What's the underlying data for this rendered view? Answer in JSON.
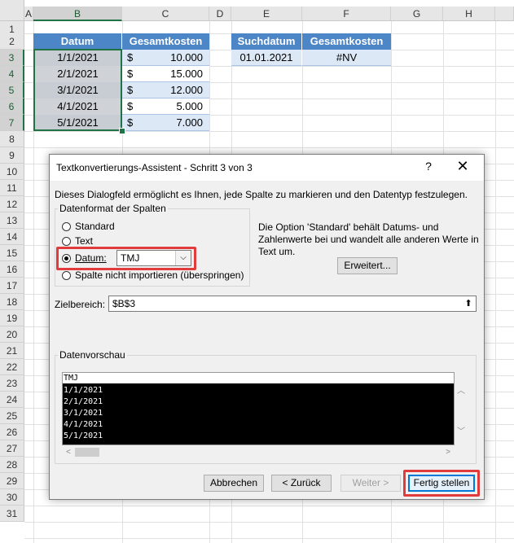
{
  "columns": [
    "A",
    "B",
    "C",
    "D",
    "E",
    "F",
    "G",
    "H"
  ],
  "rows": [
    "1",
    "2",
    "3",
    "4",
    "5",
    "6",
    "7",
    "8",
    "9",
    "10",
    "11",
    "12",
    "13",
    "14",
    "15",
    "16",
    "17",
    "18",
    "19",
    "20",
    "21",
    "22",
    "23",
    "24",
    "25",
    "26",
    "27",
    "28",
    "29",
    "30",
    "31"
  ],
  "table1": {
    "headers": [
      "Datum",
      "Gesamtkosten"
    ],
    "currency": "$",
    "rows": [
      {
        "date": "1/1/2021",
        "cost": "10.000"
      },
      {
        "date": "2/1/2021",
        "cost": "15.000"
      },
      {
        "date": "3/1/2021",
        "cost": "12.000"
      },
      {
        "date": "4/1/2021",
        "cost": "5.000"
      },
      {
        "date": "5/1/2021",
        "cost": "7.000"
      }
    ]
  },
  "table2": {
    "headers": [
      "Suchdatum",
      "Gesamtkosten"
    ],
    "row": {
      "date": "01.01.2021",
      "result": "#NV"
    }
  },
  "dialog": {
    "title": "Textkonvertierungs-Assistent - Schritt 3 von 3",
    "help": "?",
    "close": "✕",
    "description": "Dieses Dialogfeld ermöglicht es Ihnen, jede Spalte zu markieren und den Datentyp festzulegen.",
    "format_group": "Datenformat der Spalten",
    "opt_standard": "Standard",
    "opt_text": "Text",
    "opt_date": "Datum:",
    "opt_skip": "Spalte nicht importieren (überspringen)",
    "date_format": "TMJ",
    "info": "Die Option 'Standard' behält Datums- und Zahlenwerte bei und wandelt alle anderen Werte in Text um.",
    "advanced": "Erweitert...",
    "target_label": "Zielbereich:",
    "target_value": "$B$3",
    "preview_group": "Datenvorschau",
    "preview_header": "TMJ",
    "preview_rows": [
      "1/1/2021",
      "2/1/2021",
      "3/1/2021",
      "4/1/2021",
      "5/1/2021"
    ],
    "btn_cancel": "Abbrechen",
    "btn_back": "< Zurück",
    "btn_next": "Weiter >",
    "btn_finish": "Fertig stellen"
  },
  "colors": {
    "header_blue": "#4d86c6",
    "row_blue": "#dce8f5",
    "highlight_red": "#e23b3b",
    "selection_green": "#217346"
  }
}
